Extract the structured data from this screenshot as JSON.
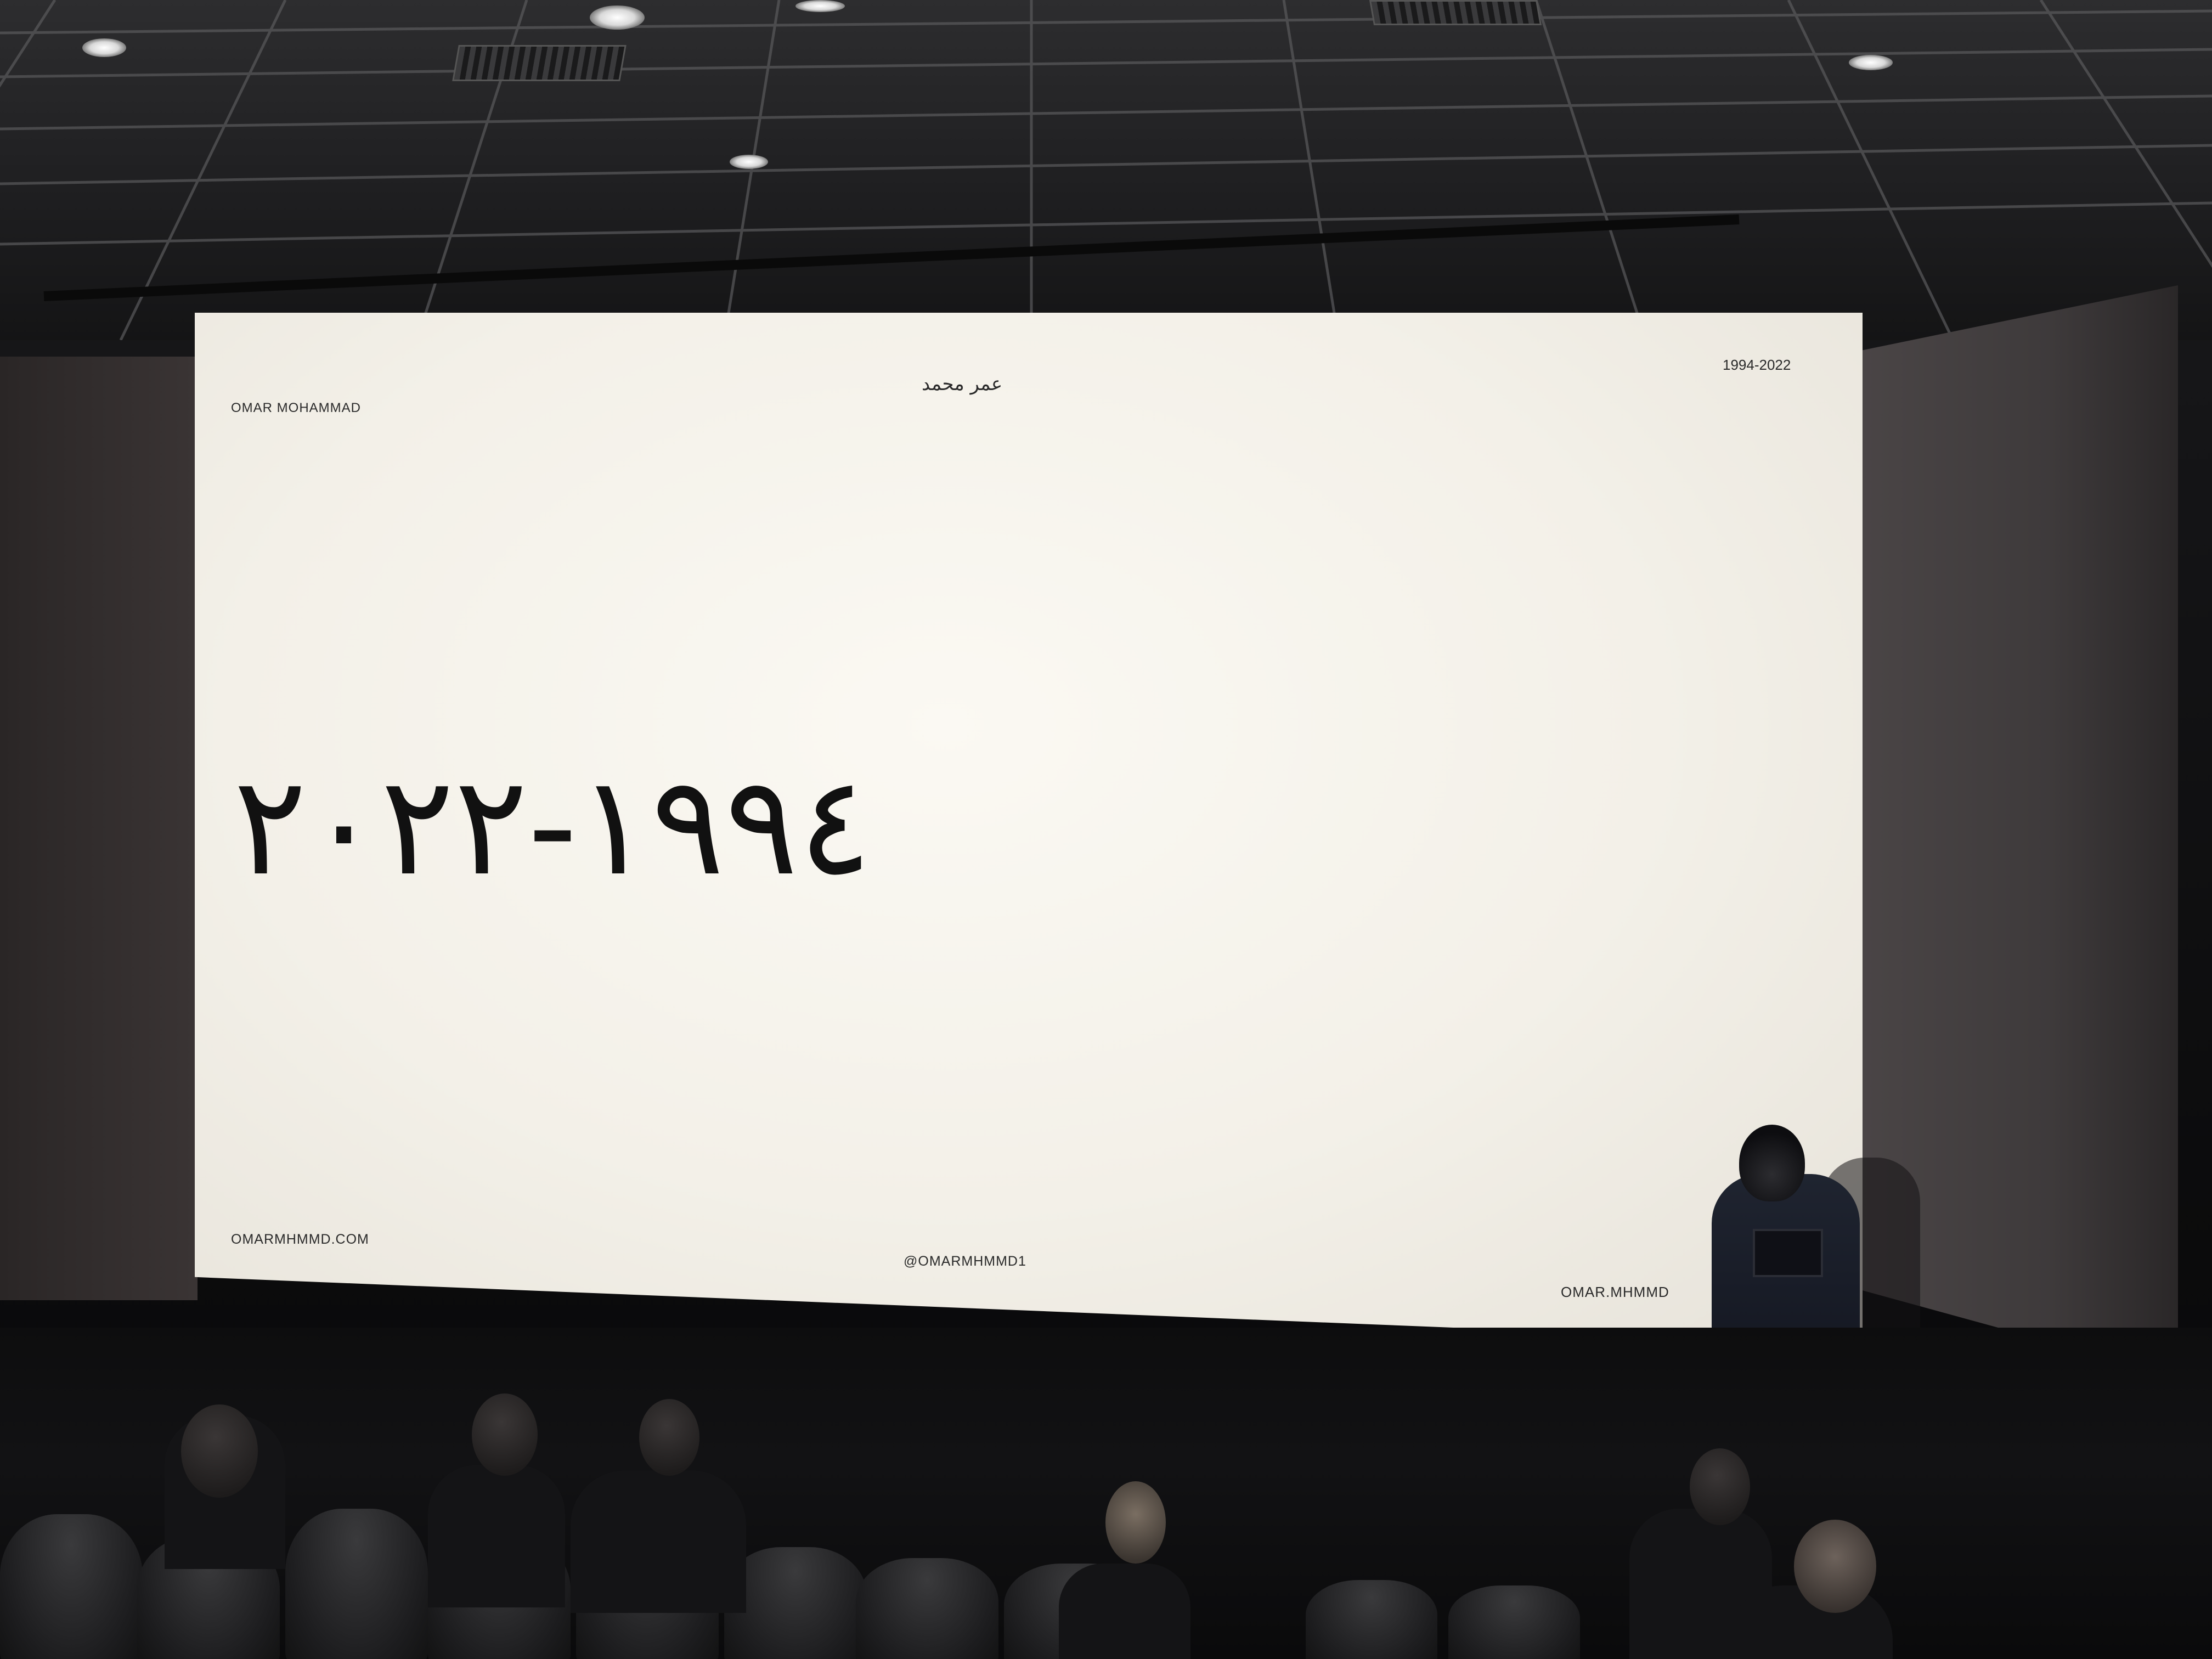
{
  "slide": {
    "name_en": "OMAR MOHAMMAD",
    "name_ar": "عمر محمد",
    "years_small": "1994-2022",
    "years_arabic": "١٩٩٤-٢٠٢٢",
    "website": "OMARMHMMD.COM",
    "handle_center": "@OMARMHMMD1",
    "handle_right": "OMAR.MHMMD"
  },
  "colors": {
    "screen": "#f3f0e8",
    "text": "#2a2a2a",
    "room": "#0b0b0c"
  }
}
